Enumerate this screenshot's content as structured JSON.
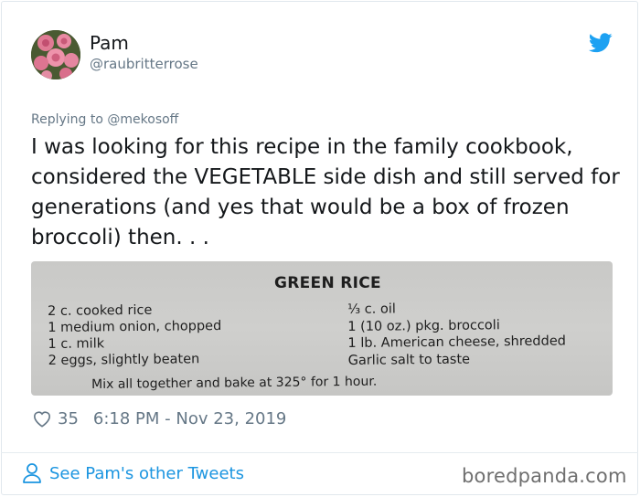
{
  "tweet": {
    "author_name": "Pam",
    "author_handle": "@raubritterrose",
    "reply_prefix": "Replying to",
    "reply_to": "@mekosoff",
    "text": "I was looking for this recipe in the family cookbook, considered the VEGETABLE side dish and still served for generations (and yes that would be a box of frozen broccoli) then. . .",
    "likes": "35",
    "timestamp": "6:18 PM - Nov 23, 2019",
    "brand_color": "#1da1f2"
  },
  "recipe_photo": {
    "title": "GREEN RICE",
    "left_lines": [
      "2 c. cooked rice",
      "1 medium onion, chopped",
      "1 c. milk",
      "2 eggs, slightly beaten"
    ],
    "right_lines": [
      "⅓ c. oil",
      "1 (10 oz.) pkg. broccoli",
      "1 lb. American cheese, shredded",
      "Garlic salt to taste"
    ],
    "instructions": "Mix all together and bake at 325° for 1 hour."
  },
  "footer": {
    "link_label": "See Pam's other Tweets",
    "watermark": "boredpanda.com"
  },
  "icons": {
    "platform": "twitter-bird-icon",
    "like": "heart-icon",
    "profile": "person-icon"
  }
}
